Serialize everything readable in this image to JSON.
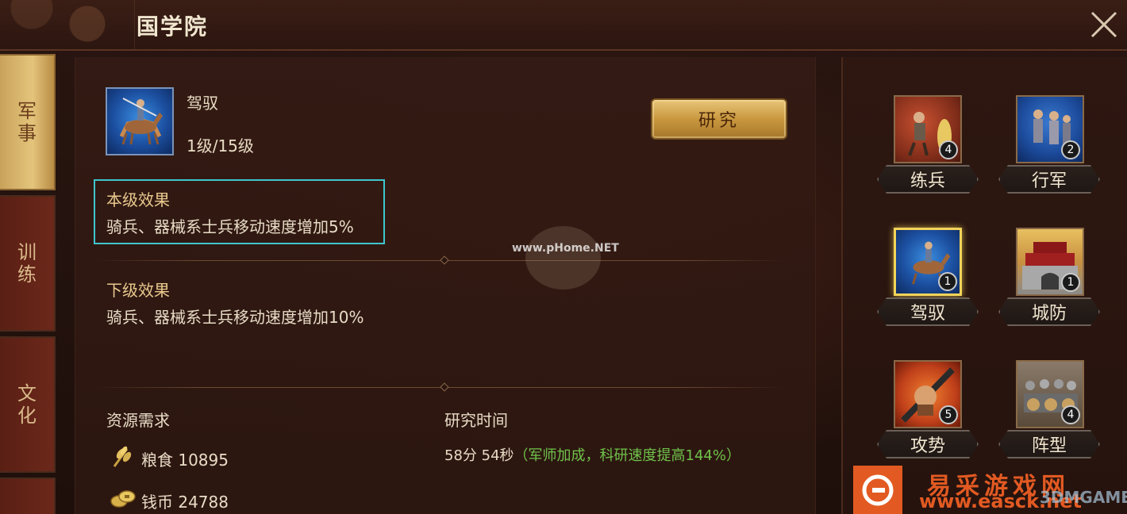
{
  "header": {
    "title": "国学院"
  },
  "tabs": [
    {
      "label_1": "军",
      "label_2": "事"
    },
    {
      "label_1": "训",
      "label_2": "练"
    },
    {
      "label_1": "文",
      "label_2": "化"
    }
  ],
  "skill": {
    "name": "驾驭",
    "level": "1级/15级",
    "research_button": "研究"
  },
  "current_effect": {
    "title": "本级效果",
    "text": "骑兵、器械系士兵移动速度增加5%"
  },
  "next_effect": {
    "title": "下级效果",
    "text": "骑兵、器械系士兵移动速度增加10%"
  },
  "resources": {
    "title": "资源需求",
    "items": [
      {
        "icon": "grain-icon",
        "label": "粮食 10895"
      },
      {
        "icon": "coin-icon",
        "label": "钱币 24788"
      }
    ]
  },
  "research_time": {
    "title": "研究时间",
    "value": "58分 54秒",
    "bonus": "（军师加成，科研速度提高144%）"
  },
  "tech_nodes": [
    {
      "label": "练兵",
      "badge": "4",
      "icon": "drill-soldier-icon"
    },
    {
      "label": "行军",
      "badge": "2",
      "icon": "march-soldiers-icon"
    },
    {
      "label": "驾驭",
      "badge": "1",
      "icon": "cavalry-icon",
      "selected": true
    },
    {
      "label": "城防",
      "badge": "1",
      "icon": "city-wall-icon"
    },
    {
      "label": "攻势",
      "badge": "5",
      "icon": "fist-weapon-icon"
    },
    {
      "label": "阵型",
      "badge": "4",
      "icon": "formation-icon"
    }
  ],
  "watermarks": {
    "center": "www.pHome.NET",
    "site_cn": "易采游戏网",
    "site_en": "www.easck.net",
    "site_3dm": "3DMGAME"
  },
  "colors": {
    "accent_gold": "#e4c47c",
    "highlight_cyan": "#3fc6cf",
    "bonus_green": "#6fc24a",
    "brand_orange": "#e25a22"
  }
}
